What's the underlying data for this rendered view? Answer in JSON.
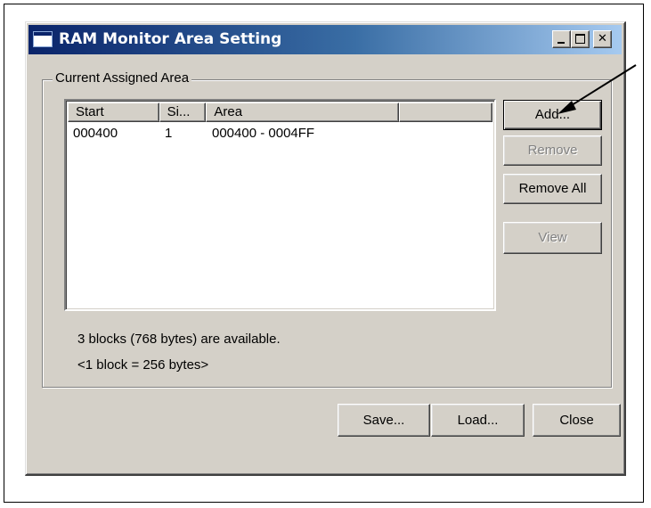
{
  "window": {
    "title": "RAM Monitor Area Setting",
    "minimize_label": "_",
    "maximize_label": "□",
    "close_label": "✕"
  },
  "group": {
    "label": "Current Assigned Area"
  },
  "list": {
    "columns": [
      "Start",
      "Si...",
      "Area",
      ""
    ],
    "rows": [
      {
        "start": "000400",
        "size": "1",
        "area": "000400 - 0004FF"
      }
    ]
  },
  "side_buttons": {
    "add": "Add...",
    "remove": "Remove",
    "remove_all": "Remove All",
    "view": "View"
  },
  "status": {
    "available": "3 blocks (768 bytes) are available.",
    "block_size": "<1 block = 256 bytes>"
  },
  "bottom_buttons": {
    "save": "Save...",
    "load": "Load...",
    "close": "Close"
  },
  "colors": {
    "title_gradient_start": "#0a246a",
    "title_gradient_end": "#a6caf0",
    "dialog_face": "#d4d0c8",
    "disabled_text": "#808080"
  }
}
